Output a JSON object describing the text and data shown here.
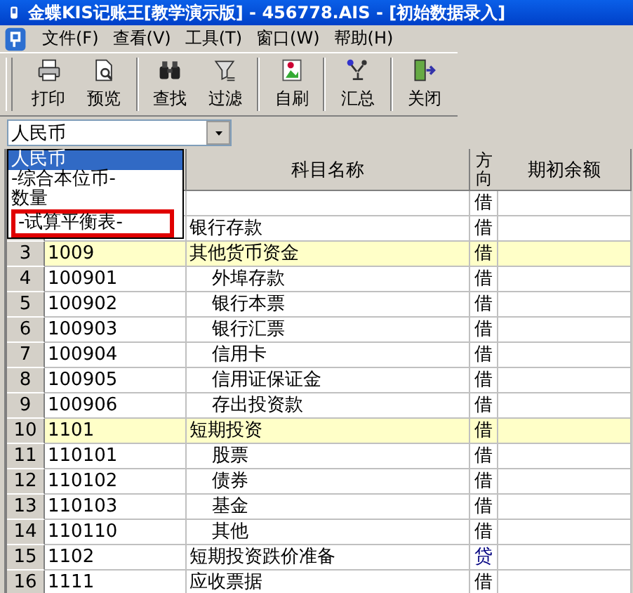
{
  "window": {
    "title": "金蝶KIS记账王[教学演示版] - 456778.AIS - [初始数据录入]"
  },
  "menu": [
    {
      "label": "文件(F)"
    },
    {
      "label": "查看(V)"
    },
    {
      "label": "工具(T)"
    },
    {
      "label": "窗口(W)"
    },
    {
      "label": "帮助(H)"
    }
  ],
  "toolbar": [
    {
      "label": "打印",
      "kind": "print"
    },
    {
      "label": "预览",
      "kind": "preview"
    },
    {
      "label": "查找",
      "kind": "find"
    },
    {
      "label": "过滤",
      "kind": "filter"
    },
    {
      "label": "自刷",
      "kind": "refresh"
    },
    {
      "label": "汇总",
      "kind": "summary"
    },
    {
      "label": "关闭",
      "kind": "close"
    }
  ],
  "currency": {
    "value": "人民币",
    "options": [
      {
        "label": "人民币",
        "selected": true
      },
      {
        "label": "-综合本位币-",
        "selected": false
      },
      {
        "label": "数量",
        "selected": false
      },
      {
        "label": "-试算平衡表-",
        "selected": false,
        "marked": true
      }
    ]
  },
  "table": {
    "columns": [
      "科目名称",
      "方向",
      "期初余额"
    ],
    "rows": [
      {
        "direction": "借",
        "color": "#000000",
        "highlighted": false
      },
      {
        "name": "银行存款",
        "direction": "借",
        "color": "#000000",
        "highlighted": false
      },
      {
        "num": "3",
        "code": "1009",
        "name": "其他货币资金",
        "direction": "借",
        "color": "#000000",
        "highlighted": true,
        "children": [
          {
            "num": "4",
            "code": "100901",
            "name": "外埠存款",
            "direction": "借",
            "color": "#000000",
            "highlighted": false
          },
          {
            "num": "5",
            "code": "100902",
            "name": "银行本票",
            "direction": "借",
            "color": "#000000",
            "highlighted": false
          },
          {
            "num": "6",
            "code": "100903",
            "name": "银行汇票",
            "direction": "借",
            "color": "#000000",
            "highlighted": false
          },
          {
            "num": "7",
            "code": "100904",
            "name": "信用卡",
            "direction": "借",
            "color": "#000000",
            "highlighted": false
          },
          {
            "num": "8",
            "code": "100905",
            "name": "信用证保证金",
            "direction": "借",
            "color": "#000000",
            "highlighted": false
          },
          {
            "num": "9",
            "code": "100906",
            "name": "存出投资款",
            "direction": "借",
            "color": "#000000",
            "highlighted": false
          }
        ]
      },
      {
        "num": "10",
        "code": "1101",
        "name": "短期投资",
        "direction": "借",
        "color": "#000000",
        "highlighted": true,
        "children": [
          {
            "num": "11",
            "code": "110101",
            "name": "股票",
            "direction": "借",
            "color": "#000000",
            "highlighted": false
          },
          {
            "num": "12",
            "code": "110102",
            "name": "债券",
            "direction": "借",
            "color": "#000000",
            "highlighted": false
          },
          {
            "num": "13",
            "code": "110103",
            "name": "基金",
            "direction": "借",
            "color": "#000000",
            "highlighted": false
          },
          {
            "num": "14",
            "code": "110110",
            "name": "其他",
            "direction": "借",
            "color": "#000000",
            "highlighted": false
          }
        ]
      },
      {
        "num": "15",
        "code": "1102",
        "name": "短期投资跌价准备",
        "direction": "贷",
        "color": "#000080",
        "highlighted": false
      },
      {
        "num": "16",
        "code": "1111",
        "name": "应收票据",
        "direction": "借",
        "color": "#000000",
        "highlighted": false
      }
    ]
  }
}
